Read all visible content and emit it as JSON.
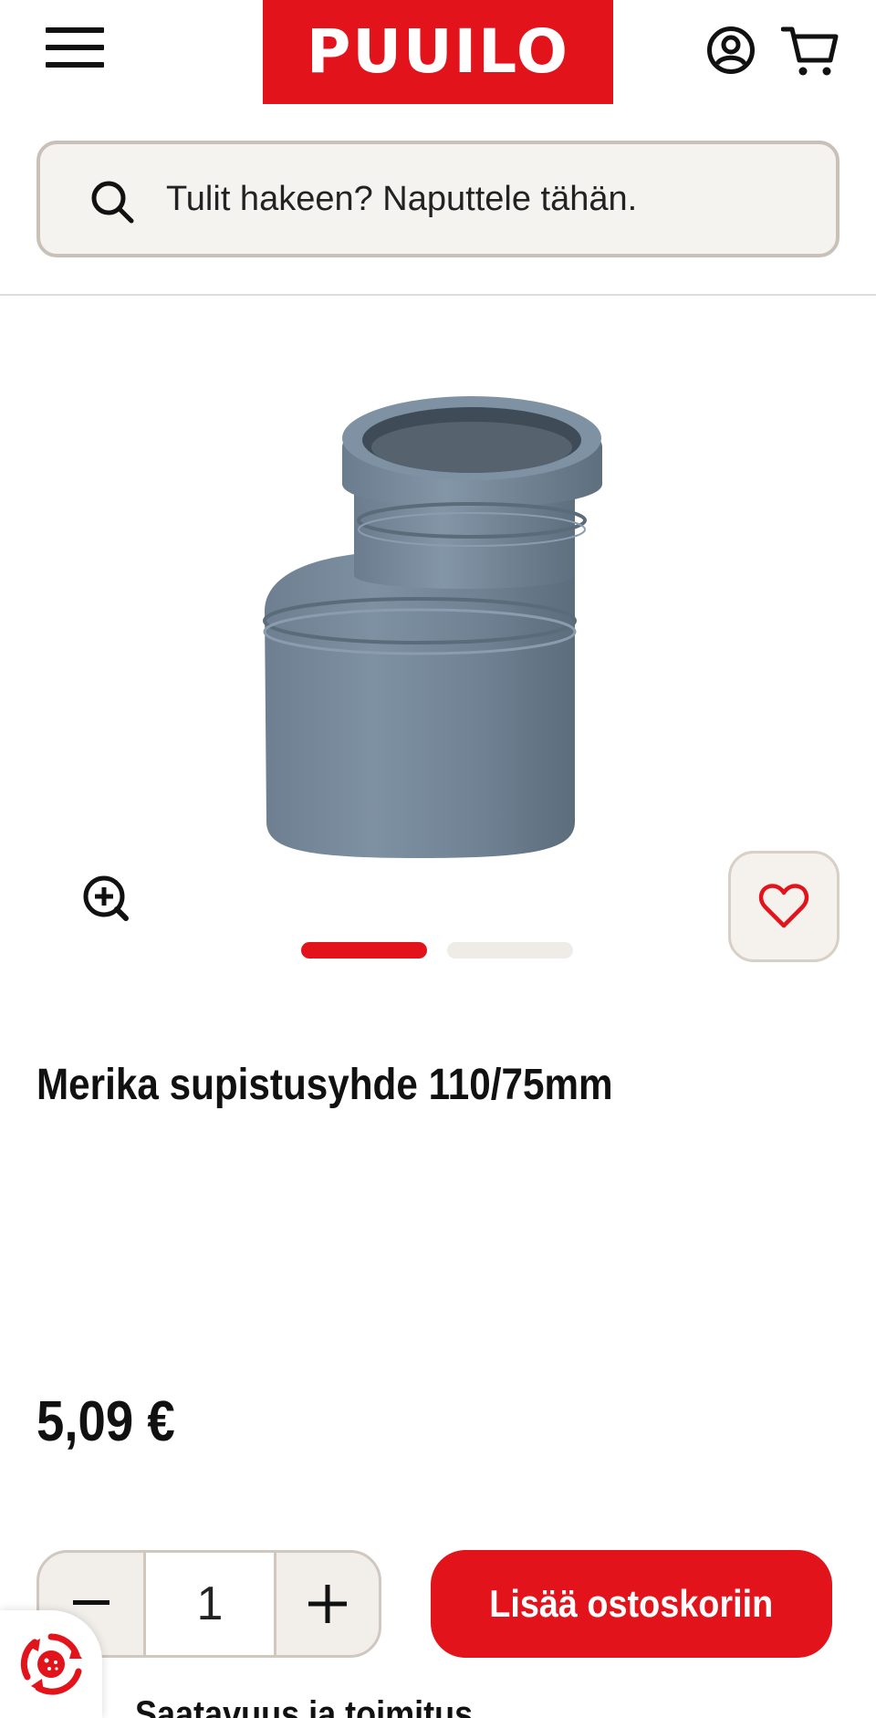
{
  "header": {
    "menu_icon": "hamburger-menu-icon",
    "logo_text": "PUUILO",
    "account_icon": "user-circle-icon",
    "cart_icon": "shopping-cart-icon",
    "brand_color": "#e3131b"
  },
  "search": {
    "icon": "search-icon",
    "placeholder": "Tulit hakeen? Naputtele tähän."
  },
  "product": {
    "image_alt": "grey reducer pipe fitting",
    "zoom_icon": "zoom-in-icon",
    "favorite_icon": "heart-icon",
    "gallery": {
      "total": 2,
      "active": 1
    },
    "title": "Merika supistusyhde 110/75mm",
    "price": "5,09 €"
  },
  "purchase": {
    "quantity": "1",
    "minus_label": "−",
    "add_to_cart_label": "Lisää ostoskoriin"
  },
  "availability": {
    "heading": "Saatavuus ja toimitus"
  },
  "cookie_badge": {
    "icon": "cookie-settings-icon"
  }
}
